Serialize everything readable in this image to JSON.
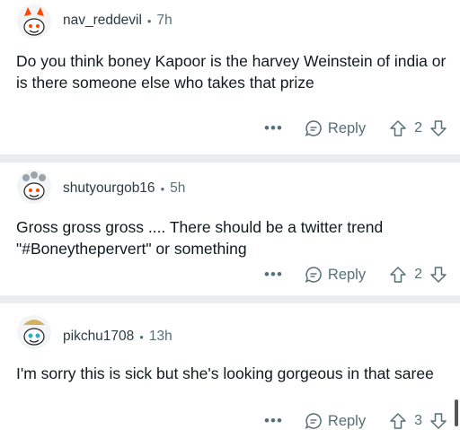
{
  "comments": [
    {
      "username": "nav_reddevil",
      "time": "7h",
      "text": "Do you think boney Kapoor is the harvey Weinstein of india or is there someone else who takes that prize",
      "more": "•••",
      "reply_label": "Reply",
      "votes": "2"
    },
    {
      "username": "shutyourgob16",
      "time": "5h",
      "text": "Gross gross gross .... There should be a twitter trend \"#Boneythepervert\" or something",
      "more": "•••",
      "reply_label": "Reply",
      "votes": "2"
    },
    {
      "username": "pikchu1708",
      "time": "13h",
      "text": "I'm sorry this is sick but she's looking gorgeous in that saree",
      "more": "•••",
      "reply_label": "Reply",
      "votes": "3"
    }
  ],
  "separator": "•",
  "colors": {
    "meta": "#576f76",
    "text": "#0f1a1c",
    "separator_bg": "#eaedef",
    "snoo_red": "#ff4500"
  },
  "icons": [
    "snoo-avatar-icon",
    "comment-bubble-icon",
    "upvote-arrow-icon",
    "downvote-arrow-icon"
  ]
}
